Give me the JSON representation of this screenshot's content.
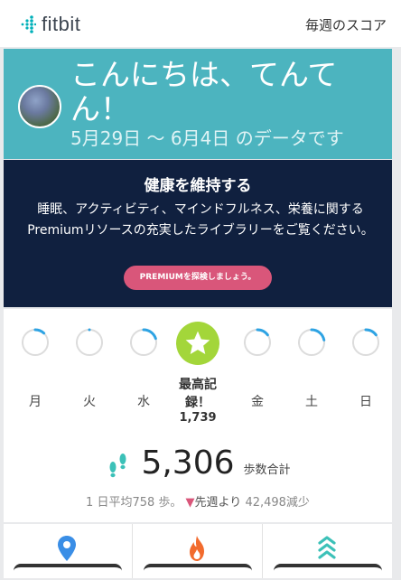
{
  "app": {
    "brand": "fitbit"
  },
  "header": {
    "weekly_score": "毎週のスコア"
  },
  "hero": {
    "greeting": "こんにちは、てんてん！",
    "date_range": "5月29日 〜 6月4日 のデータです"
  },
  "promo": {
    "title": "健康を維持する",
    "body": "睡眠、アクティビティ、マインドフルネス、栄養に関するPremiumリソースの充実したライブラリーをご覧ください。",
    "button": "PREMIUMを探検しましょう。"
  },
  "week": {
    "days": [
      {
        "label": "月",
        "progress": 0.12
      },
      {
        "label": "火",
        "progress": 0.0
      },
      {
        "label": "水",
        "progress": 0.2
      },
      {
        "label": "金",
        "progress": 0.15
      },
      {
        "label": "土",
        "progress": 0.22
      },
      {
        "label": "日",
        "progress": 0.15
      }
    ],
    "record_label": "最高記録！",
    "record_value": "1,739"
  },
  "summary": {
    "steps_total": "5,306",
    "steps_label": "歩数合計",
    "daily_avg": "1 日平均758 歩。",
    "compare_prefix": "先週より",
    "compare_value": "42,498減少"
  },
  "stats": {
    "icons": [
      "location-pin-icon",
      "flame-icon",
      "floors-icon"
    ]
  },
  "colors": {
    "hero_bg": "#4cb4bf",
    "promo_bg": "#10203f",
    "accent_pink": "#d9567a",
    "ring_blue": "#2ea3e3",
    "record_green": "#a3d63a"
  }
}
